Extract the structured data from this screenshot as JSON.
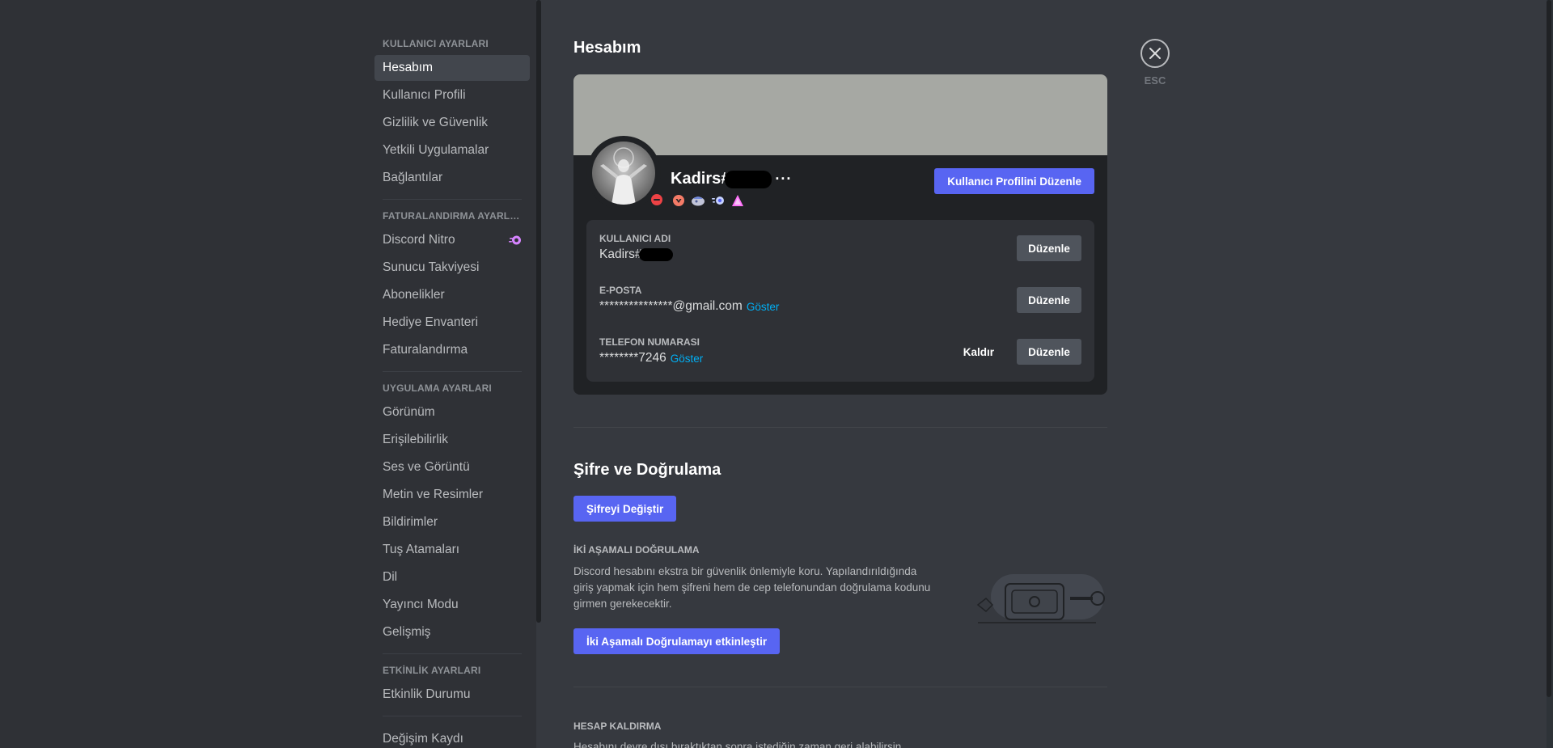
{
  "sidebar": {
    "sections": [
      {
        "header": "KULLANICI AYARLARI",
        "items": [
          "Hesabım",
          "Kullanıcı Profili",
          "Gizlilik ve Güvenlik",
          "Yetkili Uygulamalar",
          "Bağlantılar"
        ]
      },
      {
        "header": "FATURALANDIRMA AYARLA...",
        "items": [
          "Discord Nitro",
          "Sunucu Takviyesi",
          "Abonelikler",
          "Hediye Envanteri",
          "Faturalandırma"
        ]
      },
      {
        "header": "UYGULAMA AYARLARI",
        "items": [
          "Görünüm",
          "Erişilebilirlik",
          "Ses ve Görüntü",
          "Metin ve Resimler",
          "Bildirimler",
          "Tuş Atamaları",
          "Dil",
          "Yayıncı Modu",
          "Gelişmiş"
        ]
      },
      {
        "header": "ETKİNLİK AYARLARI",
        "items": [
          "Etkinlik Durumu"
        ]
      },
      {
        "header": "",
        "items": [
          "Değişim Kaydı"
        ]
      }
    ],
    "active_item": "Hesabım"
  },
  "page": {
    "title": "Hesabım"
  },
  "profile": {
    "display_name": "Kadirs#",
    "edit_profile_button": "Kullanıcı Profilini Düzenle",
    "status": "dnd"
  },
  "account": {
    "username": {
      "label": "KULLANICI ADI",
      "value": "Kadirs#",
      "edit_button": "Düzenle"
    },
    "email": {
      "label": "E-POSTA",
      "value": "***************@gmail.com",
      "show_link": "Göster",
      "edit_button": "Düzenle"
    },
    "phone": {
      "label": "TELEFON NUMARASI",
      "value": "********7246",
      "show_link": "Göster",
      "remove_button": "Kaldır",
      "edit_button": "Düzenle"
    }
  },
  "security": {
    "title": "Şifre ve Doğrulama",
    "change_password_button": "Şifreyi Değiştir",
    "tfa_header": "İKİ AŞAMALI DOĞRULAMA",
    "tfa_description": "Discord hesabını ekstra bir güvenlik önlemiyle koru. Yapılandırıldığında giriş yapmak için hem şifreni hem de cep telefonundan doğrulama kodunu girmen gerekecektir.",
    "enable_tfa_button": "İki Aşamalı Doğrulamayı etkinleştir"
  },
  "account_removal": {
    "header": "HESAP KALDIRMA",
    "description": "Hesabını devre dışı bıraktıktan sonra istediğin zaman geri alabilirsin."
  },
  "close": {
    "esc_label": "ESC"
  },
  "colors": {
    "accent": "#5865f2",
    "link": "#00aff4",
    "dnd": "#ed4245",
    "banner": "#a6a8a3"
  }
}
